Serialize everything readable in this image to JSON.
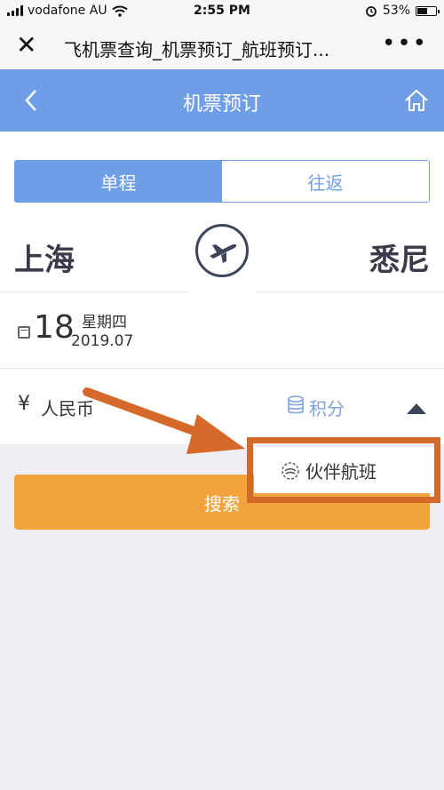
{
  "status_bar": {
    "carrier": "vodafone AU",
    "time": "2:55 PM",
    "battery_percent": "53%",
    "battery_level": 0.53
  },
  "nav_bar": {
    "title": "飞机票查询_机票预订_航班预订..."
  },
  "header": {
    "title": "机票预订"
  },
  "trip_type": {
    "options": [
      "单程",
      "往返"
    ],
    "selected": "单程"
  },
  "route": {
    "from": "上海",
    "to": "悉尼"
  },
  "date": {
    "day": "18",
    "weekday": "星期四",
    "year_month": "2019.07"
  },
  "payment": {
    "currency_symbol": "¥",
    "currency_label": "人民币",
    "points_label": "积分"
  },
  "dropdown": {
    "partner_label": "伙伴航班"
  },
  "search_button": {
    "label": "搜索"
  },
  "colors": {
    "primary_blue": "#6e9fe6",
    "search_orange": "#f2a33d",
    "annotation_orange": "#d4692a"
  },
  "icons": [
    "close-icon",
    "more-icon",
    "back-icon",
    "home-icon",
    "plane-icon",
    "calendar-icon",
    "database-icon",
    "caret-up-icon",
    "partner-logo-icon",
    "wifi-icon",
    "alarm-icon",
    "battery-icon",
    "signal-icon"
  ]
}
